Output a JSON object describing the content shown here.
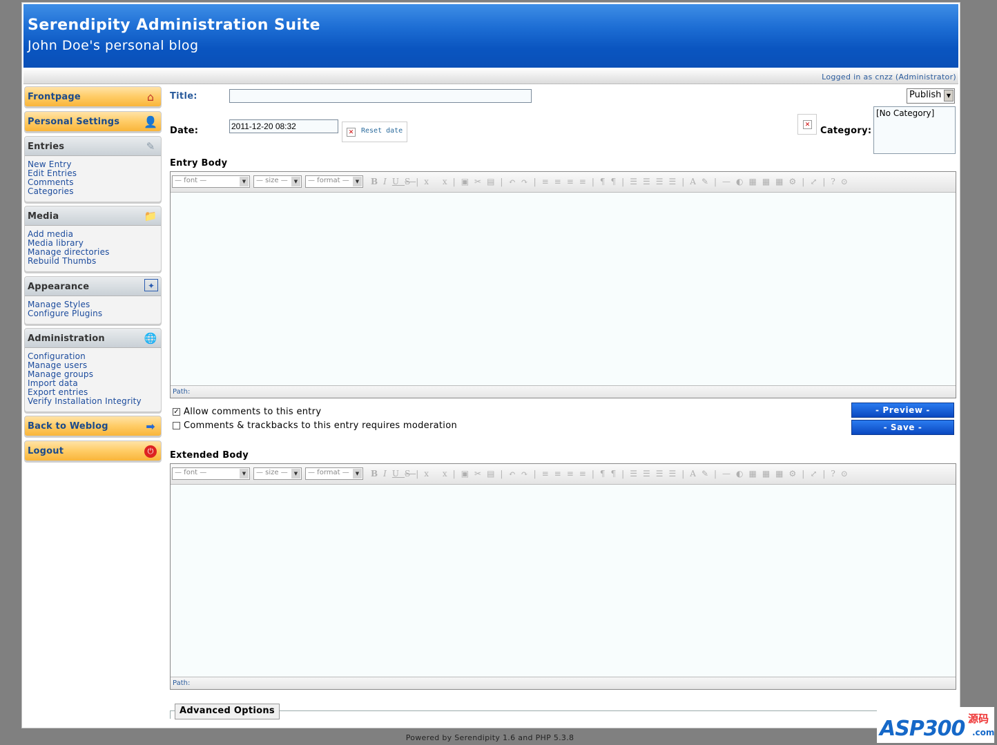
{
  "header": {
    "title": "Serendipity Administration Suite",
    "subtitle": "John Doe's personal blog",
    "logged_in": "Logged in as cnzz (Administrator)"
  },
  "sidebar": {
    "frontpage": "Frontpage",
    "personal_settings": "Personal Settings",
    "entries": {
      "title": "Entries",
      "items": [
        "New Entry",
        "Edit Entries",
        "Comments",
        "Categories"
      ]
    },
    "media": {
      "title": "Media",
      "items": [
        "Add media",
        "Media library",
        "Manage directories",
        "Rebuild Thumbs"
      ]
    },
    "appearance": {
      "title": "Appearance",
      "items": [
        "Manage Styles",
        "Configure Plugins"
      ]
    },
    "administration": {
      "title": "Administration",
      "items": [
        "Configuration",
        "Manage users",
        "Manage groups",
        "Import data",
        "Export entries",
        "Verify Installation Integrity"
      ]
    },
    "back_to_weblog": "Back to Weblog",
    "logout": "Logout"
  },
  "form": {
    "title_label": "Title:",
    "title_value": "",
    "status_select": "Publish",
    "date_label": "Date:",
    "date_value": "2011-12-20 08:32",
    "reset_date": "Reset date",
    "category_label": "Category:",
    "category_option": "[No Category]",
    "entry_body_label": "Entry Body",
    "extended_body_label": "Extended Body",
    "path_label": "Path:",
    "toolbar": {
      "font": "— font —",
      "size": "— size —",
      "format": "— format —"
    },
    "allow_comments": "Allow comments to this entry",
    "allow_comments_checked": true,
    "moderation": "Comments & trackbacks to this entry requires moderation",
    "moderation_checked": false,
    "preview_button": "- Preview -",
    "save_button": "- Save -",
    "advanced_options": "Advanced Options"
  },
  "footer": "Powered by Serendipity 1.6 and PHP 5.3.8",
  "watermark": {
    "brand": "ASP300",
    "suffix": "源码",
    "domain": ".com"
  }
}
